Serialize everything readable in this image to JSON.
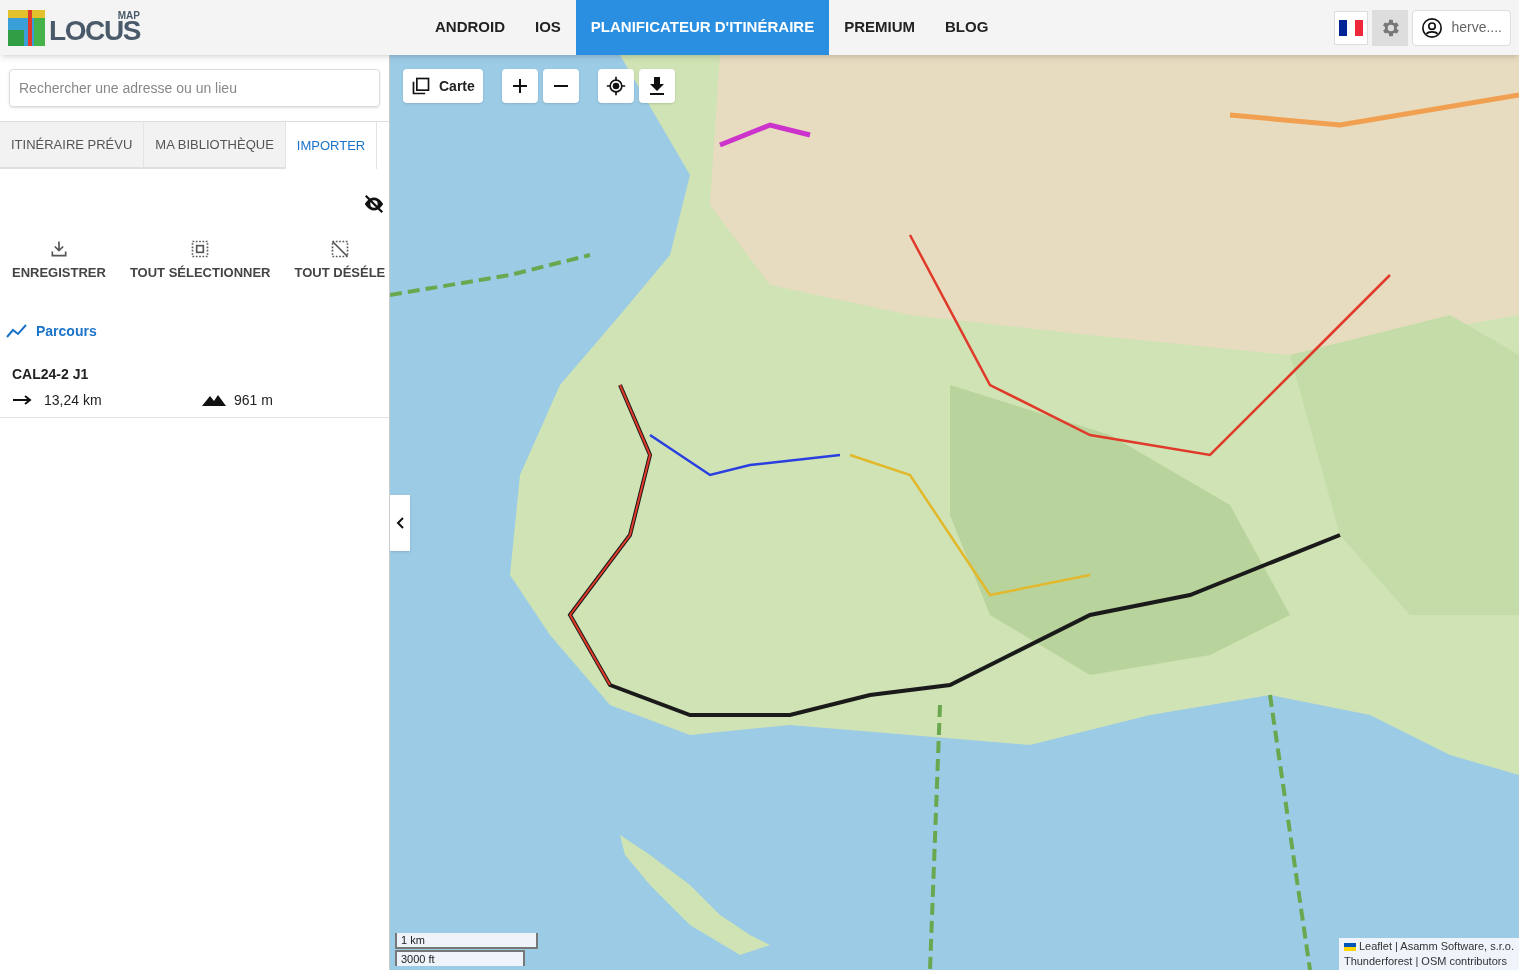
{
  "logo": {
    "top": "MAP",
    "name": "LOCUS"
  },
  "nav": [
    {
      "label": "ANDROID",
      "selected": false
    },
    {
      "label": "IOS",
      "selected": false
    },
    {
      "label": "PLANIFICATEUR D'ITINÉRAIRE",
      "selected": true
    },
    {
      "label": "PREMIUM",
      "selected": false
    },
    {
      "label": "BLOG",
      "selected": false
    }
  ],
  "user": {
    "name": "herve...."
  },
  "search": {
    "placeholder": "Rechercher une adresse ou un lieu"
  },
  "tabs": [
    {
      "label": "ITINÉRAIRE PRÉVU",
      "selected": false
    },
    {
      "label": "MA BIBLIOTHÈQUE",
      "selected": false
    },
    {
      "label": "IMPORTER",
      "selected": true
    }
  ],
  "actions": [
    {
      "kind": "save",
      "label": "ENREGISTRER"
    },
    {
      "kind": "select_all",
      "label": "TOUT SÉLECTIONNER"
    },
    {
      "kind": "deselect_all",
      "label": "TOUT DÉSÉLE"
    }
  ],
  "section": {
    "title": "Parcours"
  },
  "tracks": [
    {
      "name": "CAL24-2 J1",
      "distance": "13,24 km",
      "elevation": "961 m"
    }
  ],
  "map": {
    "layer_button": "Carte",
    "scale": [
      "1 km",
      "3000 ft"
    ],
    "attribution": [
      "Leaflet | Asamm Software, s.r.o.",
      "Thunderforest | OSM contributors"
    ]
  }
}
